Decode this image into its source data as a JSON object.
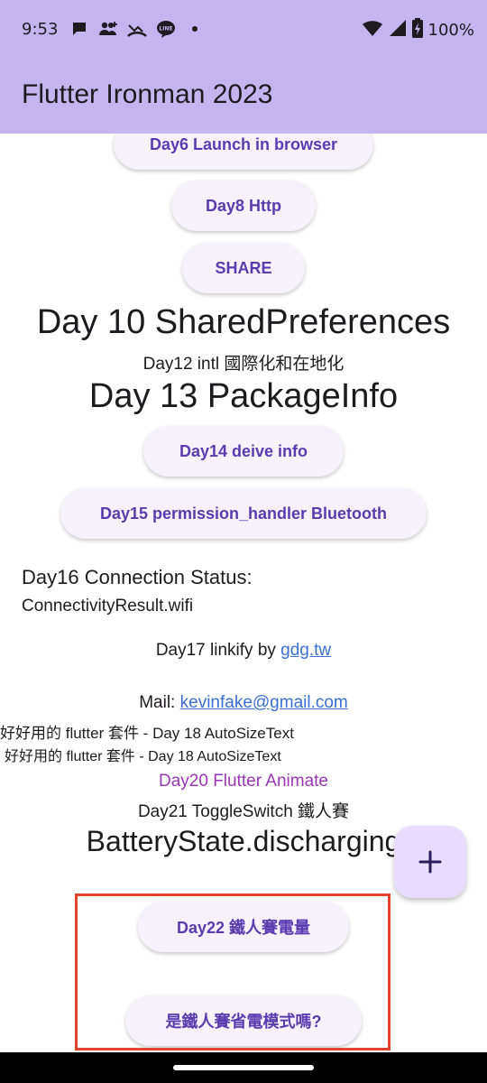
{
  "status_bar": {
    "time": "9:53",
    "battery": "100%",
    "notification_icons": [
      "chat-bubble-icon",
      "group-add-icon",
      "missed-call-icon",
      "line-app-icon",
      "dot-icon"
    ],
    "system_icons": [
      "wifi-icon",
      "signal-icon",
      "battery-charging-icon"
    ]
  },
  "app_bar": {
    "title": "Flutter Ironman 2023",
    "background": "#c4b5f1"
  },
  "buttons": {
    "day6": "Day6 Launch in browser",
    "day8": "Day8 Http",
    "share": "SHARE",
    "day14": "Day14 deive info",
    "day15": "Day15 permission_handler Bluetooth",
    "day22": "Day22 鐵人賽電量",
    "power_save": "是鐵人賽省電模式嗎?"
  },
  "texts": {
    "day10": "Day 10 SharedPreferences",
    "day12": "Day12 intl 國際化和在地化",
    "day13": "Day 13 PackageInfo",
    "day16_title": "Day16 Connection Status:",
    "day16_value": "ConnectivityResult.wifi",
    "day17_prefix": "Day17 linkify by ",
    "day17_link": "gdg.tw",
    "mail_prefix": "Mail: ",
    "mail_link": "kevinfake@gmail.com",
    "autosize_1": "好好用的 flutter 套件 - Day 18 AutoSizeText",
    "autosize_2": "好好用的 flutter 套件 - Day 18 AutoSizeText",
    "day20": "Day20 Flutter Animate",
    "day21": "Day21 ToggleSwitch 鐵人賽",
    "battery_state": "BatteryState.discharging"
  },
  "fab": {
    "icon": "add-icon"
  },
  "colors": {
    "accent": "#5a3cb0",
    "animate_text": "#9b36b7",
    "link": "#3b6fd4",
    "highlight": "#e2432e",
    "fab": "#e9ddff"
  }
}
